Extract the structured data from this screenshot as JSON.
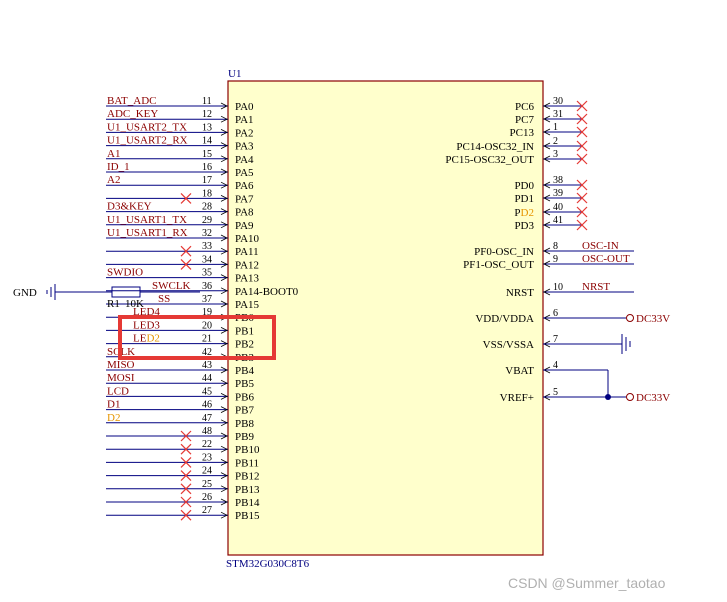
{
  "component": {
    "designator": "U1",
    "part": "STM32G030C8T6",
    "body_color": "#ffffcc"
  },
  "left_pins": [
    {
      "name": "PA0",
      "num": "11",
      "net": "BAT_ADC"
    },
    {
      "name": "PA1",
      "num": "12",
      "net": "ADC_KEY"
    },
    {
      "name": "PA2",
      "num": "13",
      "net": "U1_USART2_TX"
    },
    {
      "name": "PA3",
      "num": "14",
      "net": "U1_USART2_RX"
    },
    {
      "name": "PA4",
      "num": "15",
      "net": "A1"
    },
    {
      "name": "PA5",
      "num": "16",
      "net": "ID_1"
    },
    {
      "name": "PA6",
      "num": "17",
      "net": "A2"
    },
    {
      "name": "PA7",
      "num": "18",
      "net": "",
      "nc": true
    },
    {
      "name": "PA8",
      "num": "28",
      "net": "D3&KEY"
    },
    {
      "name": "PA9",
      "num": "29",
      "net": "U1_USART1_TX"
    },
    {
      "name": "PA10",
      "num": "32",
      "net": "U1_USART1_RX"
    },
    {
      "name": "PA11",
      "num": "33",
      "net": "",
      "nc": true
    },
    {
      "name": "PA12",
      "num": "34",
      "net": "",
      "nc": true
    },
    {
      "name": "PA13",
      "num": "35",
      "net": "SWDIO"
    },
    {
      "name": "PA14-BOOT0",
      "num": "36",
      "net": "SWCLK"
    },
    {
      "name": "PA15",
      "num": "37",
      "net": "SS"
    },
    {
      "name": "PB0",
      "num": "19",
      "net": "LED4"
    },
    {
      "name": "PB1",
      "num": "20",
      "net": "LED3"
    },
    {
      "name": "PB2",
      "num": "21",
      "net": "LED2"
    },
    {
      "name": "PB3",
      "num": "42",
      "net": "SCLK"
    },
    {
      "name": "PB4",
      "num": "43",
      "net": "MISO"
    },
    {
      "name": "PB5",
      "num": "44",
      "net": "MOSI"
    },
    {
      "name": "PB6",
      "num": "45",
      "net": "LCD"
    },
    {
      "name": "PB7",
      "num": "46",
      "net": "D1"
    },
    {
      "name": "PB8",
      "num": "47",
      "net": "D2"
    },
    {
      "name": "PB9",
      "num": "48",
      "net": "",
      "nc": true
    },
    {
      "name": "PB10",
      "num": "22",
      "net": "",
      "nc": true
    },
    {
      "name": "PB11",
      "num": "23",
      "net": "",
      "nc": true
    },
    {
      "name": "PB12",
      "num": "24",
      "net": "",
      "nc": true
    },
    {
      "name": "PB13",
      "num": "25",
      "net": "",
      "nc": true
    },
    {
      "name": "PB14",
      "num": "26",
      "net": "",
      "nc": true
    },
    {
      "name": "PB15",
      "num": "27",
      "net": "",
      "nc": true
    }
  ],
  "right_pins": [
    {
      "name": "PC6",
      "num": "30",
      "net": "",
      "nc": true
    },
    {
      "name": "PC7",
      "num": "31",
      "net": "",
      "nc": true
    },
    {
      "name": "PC13",
      "num": "1",
      "net": "",
      "nc": true
    },
    {
      "name": "PC14-OSC32_IN",
      "num": "2",
      "net": "",
      "nc": true
    },
    {
      "name": "PC15-OSC32_OUT",
      "num": "3",
      "net": "",
      "nc": true
    },
    {
      "name": "PD0",
      "num": "38",
      "net": "",
      "nc": true
    },
    {
      "name": "PD1",
      "num": "39",
      "net": "",
      "nc": true
    },
    {
      "name": "PD2",
      "num": "40",
      "net": "",
      "nc": true
    },
    {
      "name": "PD3",
      "num": "41",
      "net": "",
      "nc": true
    },
    {
      "name": "PF0-OSC_IN",
      "num": "8",
      "net": "OSC-IN"
    },
    {
      "name": "PF1-OSC_OUT",
      "num": "9",
      "net": "OSC-OUT"
    },
    {
      "name": "NRST",
      "num": "10",
      "net": "NRST"
    },
    {
      "name": "VDD/VDDA",
      "num": "6",
      "net": ""
    },
    {
      "name": "VSS/VSSA",
      "num": "7",
      "net": ""
    },
    {
      "name": "VBAT",
      "num": "4",
      "net": ""
    },
    {
      "name": "VREF+",
      "num": "5",
      "net": ""
    }
  ],
  "power": {
    "vdd_label": "DC33V",
    "vref_label": "DC33V",
    "gnd_label": "GND"
  },
  "resistor": {
    "designator": "R1",
    "value": "10K"
  },
  "highlight": {
    "color": "#e53935"
  },
  "watermark": "CSDN @Summer_taotao"
}
